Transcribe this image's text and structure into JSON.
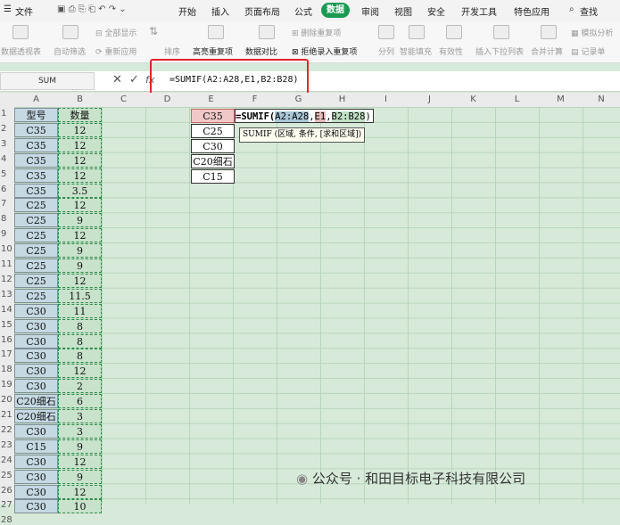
{
  "menu": {
    "file": "文件",
    "tabs": [
      "开始",
      "插入",
      "页面布局",
      "公式",
      "数据",
      "审阅",
      "视图",
      "安全",
      "开发工具",
      "特色应用"
    ],
    "active_tab": "数据",
    "search": "查找"
  },
  "ribbon": {
    "items": [
      "数据透视表",
      "自动筛选",
      "全部显示",
      "重新应用",
      "排序",
      "高亮重复项",
      "数据对比",
      "删除重复项",
      "拒绝录入重复项",
      "分列",
      "智能填充",
      "有效性",
      "插入下拉列表",
      "合并计算",
      "模拟分析",
      "记录单"
    ]
  },
  "formula_bar": {
    "name_box": "SUM",
    "formula": "=SUMIF(A2:A28,E1,B2:B28)"
  },
  "columns": [
    "A",
    "B",
    "C",
    "D",
    "E",
    "F",
    "G",
    "H",
    "I",
    "J",
    "K",
    "L",
    "M",
    "N"
  ],
  "rows": [
    "1",
    "2",
    "3",
    "4",
    "5",
    "6",
    "7",
    "8",
    "9",
    "10",
    "11",
    "12",
    "13",
    "14",
    "15",
    "16",
    "17",
    "18",
    "19",
    "20",
    "21",
    "22",
    "23",
    "24",
    "25",
    "26",
    "27",
    "28"
  ],
  "table": {
    "header": [
      "型号",
      "数量"
    ],
    "data": [
      [
        "C35",
        "12"
      ],
      [
        "C35",
        "12"
      ],
      [
        "C35",
        "12"
      ],
      [
        "C35",
        "12"
      ],
      [
        "C35",
        "3.5"
      ],
      [
        "C25",
        "12"
      ],
      [
        "C25",
        "9"
      ],
      [
        "C25",
        "12"
      ],
      [
        "C25",
        "9"
      ],
      [
        "C25",
        "9"
      ],
      [
        "C25",
        "12"
      ],
      [
        "C25",
        "11.5"
      ],
      [
        "C30",
        "11"
      ],
      [
        "C30",
        "8"
      ],
      [
        "C30",
        "8"
      ],
      [
        "C30",
        "8"
      ],
      [
        "C30",
        "12"
      ],
      [
        "C30",
        "2"
      ],
      [
        "C20细石",
        "6"
      ],
      [
        "C20细石",
        "3"
      ],
      [
        "C30",
        "3"
      ],
      [
        "C15",
        "9"
      ],
      [
        "C30",
        "12"
      ],
      [
        "C30",
        "9"
      ],
      [
        "C30",
        "12"
      ],
      [
        "C30",
        "10"
      ]
    ]
  },
  "criteria": [
    "C35",
    "C25",
    "C30",
    "C20细石",
    "C15"
  ],
  "active_cell_formula": {
    "prefix": "=SUMIF(",
    "range": "A2:A28",
    "sep1": ",",
    "criteria": "E1",
    "sep2": ",",
    "sum_range": "B2:B28",
    "suffix": ")"
  },
  "tooltip": "SUMIF (区域, 条件, [求和区域])",
  "watermark": "公众号 · 和田目标电子科技有限公司",
  "colors": {
    "accent": "#1a9a52",
    "highlight_box": "#e0262a",
    "sheet_bg": "#d7ead9"
  }
}
